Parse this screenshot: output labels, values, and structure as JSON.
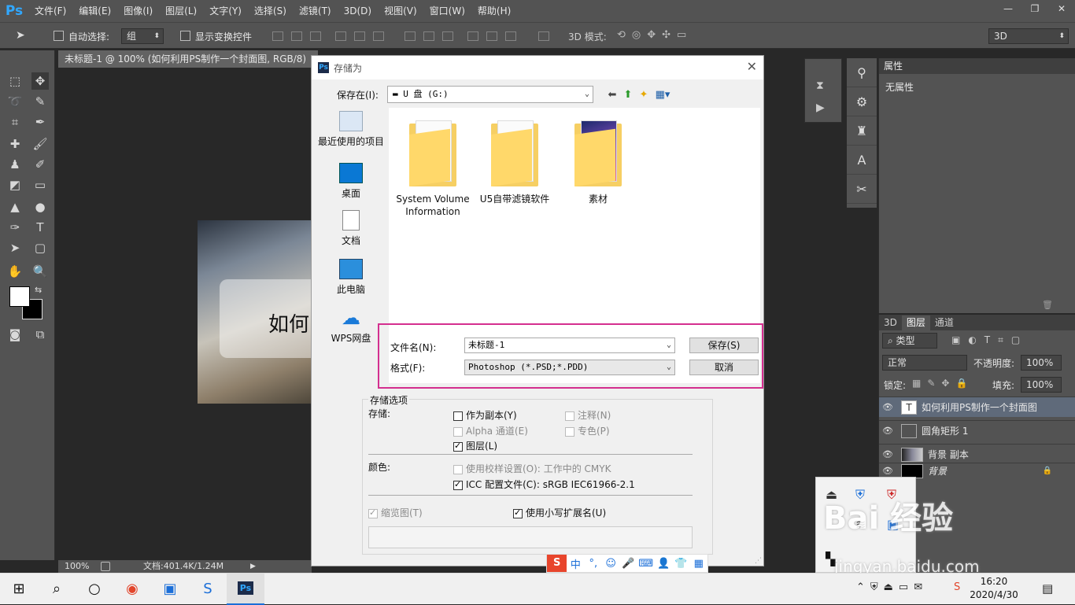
{
  "app": {
    "logo": "Ps"
  },
  "menu": [
    "文件(F)",
    "编辑(E)",
    "图像(I)",
    "图层(L)",
    "文字(Y)",
    "选择(S)",
    "滤镜(T)",
    "3D(D)",
    "视图(V)",
    "窗口(W)",
    "帮助(H)"
  ],
  "window_controls": {
    "minimize": "—",
    "restore": "❐",
    "close": "✕"
  },
  "options_bar": {
    "auto_select_label": "自动选择:",
    "auto_select_value": "组",
    "show_transform_label": "显示变换控件",
    "mode_3d_label": "3D 模式:",
    "workspace_value": "3D"
  },
  "document": {
    "tab_title": "未标题-1 @ 100% (如何利用PS制作一个封面图, RGB/8)",
    "canvas_text": "如何",
    "zoom": "100%",
    "doc_size": "文档:401.4K/1.24M"
  },
  "panels": {
    "properties_tab": "属性",
    "properties_empty": "无属性",
    "layer_tabs": [
      "3D",
      "图层",
      "通道"
    ],
    "filter_kind": "类型",
    "blend_mode": "正常",
    "opacity_label": "不透明度:",
    "opacity_value": "100%",
    "lock_label": "锁定:",
    "fill_label": "填充:",
    "fill_value": "100%",
    "layers": [
      {
        "name": "如何利用PS制作一个封面图",
        "kind": "T"
      },
      {
        "name": "圆角矩形 1",
        "kind": "shape"
      },
      {
        "name": "背景 副本",
        "kind": "image"
      },
      {
        "name": "背景",
        "kind": "bg"
      }
    ]
  },
  "dialog": {
    "title": "存储为",
    "save_in_label": "保存在(I):",
    "save_in_value": "U 盘 (G:)",
    "places": [
      "最近使用的项目",
      "桌面",
      "文档",
      "此电脑",
      "WPS网盘"
    ],
    "folders": [
      {
        "name": "System Volume Information"
      },
      {
        "name": "U5自带滤镜软件"
      },
      {
        "name": "素材"
      }
    ],
    "filename_label": "文件名(N):",
    "filename_value": "未标题-1",
    "format_label": "格式(F):",
    "format_value": "Photoshop (*.PSD;*.PDD)",
    "save_button": "保存(S)",
    "cancel_button": "取消",
    "options_title": "存储选项",
    "storage_label": "存储:",
    "as_copy": "作为副本(Y)",
    "notes": "注释(N)",
    "alpha": "Alpha 通道(E)",
    "spot": "专色(P)",
    "layers_opt": "图层(L)",
    "color_label": "颜色:",
    "proof": "使用校样设置(O):",
    "proof_value": "工作中的 CMYK",
    "icc": "ICC 配置文件(C):",
    "icc_value": "sRGB IEC61966-2.1",
    "thumbnail": "缩览图(T)",
    "lowercase": "使用小写扩展名(U)"
  },
  "ime": {
    "logo": "S",
    "mode": "中"
  },
  "taskbar": {
    "time": "16:20",
    "date": "2020/4/30"
  },
  "watermark": {
    "main": "Bai 经验",
    "sub": "jingyan.baidu.com"
  }
}
